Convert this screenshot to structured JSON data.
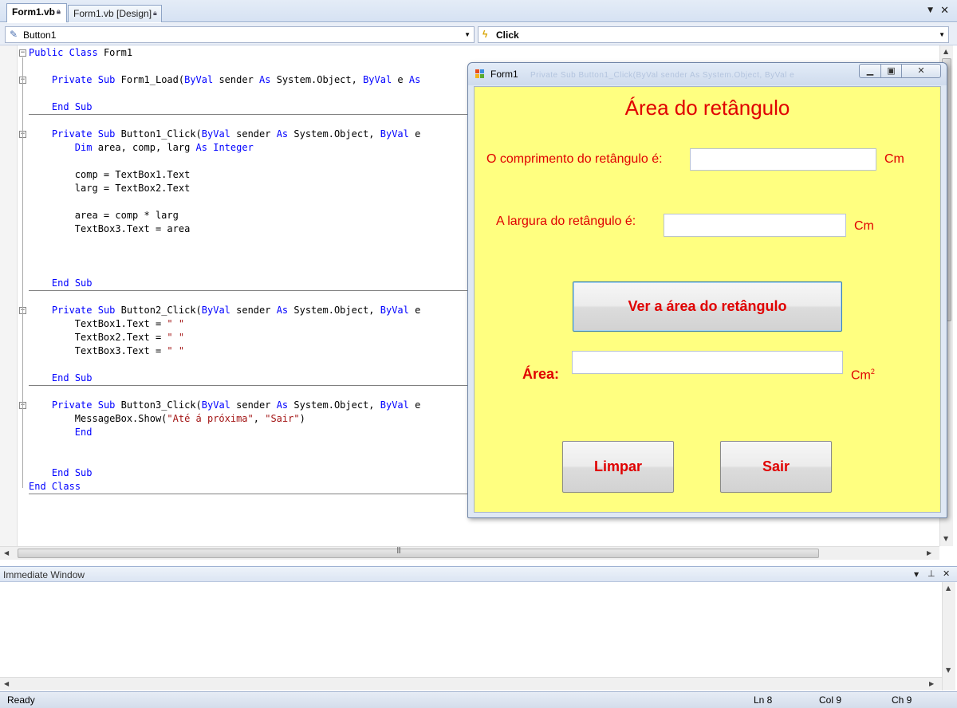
{
  "tabs": [
    {
      "label": "Form1.vb",
      "active": true
    },
    {
      "label": "Form1.vb [Design]",
      "active": false
    }
  ],
  "dropdowns": {
    "object": "Button1",
    "event": "Click"
  },
  "code": [
    "Public Class Form1",
    "",
    "    Private Sub Form1_Load(ByVal sender As System.Object, ByVal e As",
    "",
    "    End Sub",
    "",
    "    Private Sub Button1_Click(ByVal sender As System.Object, ByVal e",
    "        Dim area, comp, larg As Integer",
    "",
    "        comp = TextBox1.Text",
    "        larg = TextBox2.Text",
    "",
    "        area = comp * larg",
    "        TextBox3.Text = area",
    "",
    "",
    "",
    "    End Sub",
    "",
    "    Private Sub Button2_Click(ByVal sender As System.Object, ByVal e",
    "        TextBox1.Text = \" \"",
    "        TextBox2.Text = \" \"",
    "        TextBox3.Text = \" \"",
    "",
    "    End Sub",
    "",
    "    Private Sub Button3_Click(ByVal sender As System.Object, ByVal e",
    "        MessageBox.Show(\"Até á próxima\", \"Sair\")",
    "        End",
    "",
    "",
    "    End Sub",
    "End Class"
  ],
  "immediate_window": {
    "title": "Immediate Window"
  },
  "status": {
    "ready": "Ready",
    "ln": "Ln 8",
    "col": "Col 9",
    "ch": "Ch 9"
  },
  "form": {
    "title": "Form1",
    "ghost_text": "Private Sub Button1_Click(ByVal sender As System.Object, ByVal e",
    "heading": "Área do retângulo",
    "length_label": "O comprimento do retângulo é:",
    "length_unit": "Cm",
    "width_label": "A largura do retângulo é:",
    "width_unit": "Cm",
    "calc_button": "Ver a área do retângulo",
    "area_label": "Área:",
    "area_unit": "Cm",
    "area_unit_exp": "2",
    "clear_button": "Limpar",
    "exit_button": "Sair",
    "textbox1_value": "",
    "textbox2_value": "",
    "textbox3_value": ""
  },
  "colors": {
    "form_background": "#ffff80",
    "label_text": "#e00000",
    "keyword": "#0000ff",
    "string": "#a31515"
  }
}
